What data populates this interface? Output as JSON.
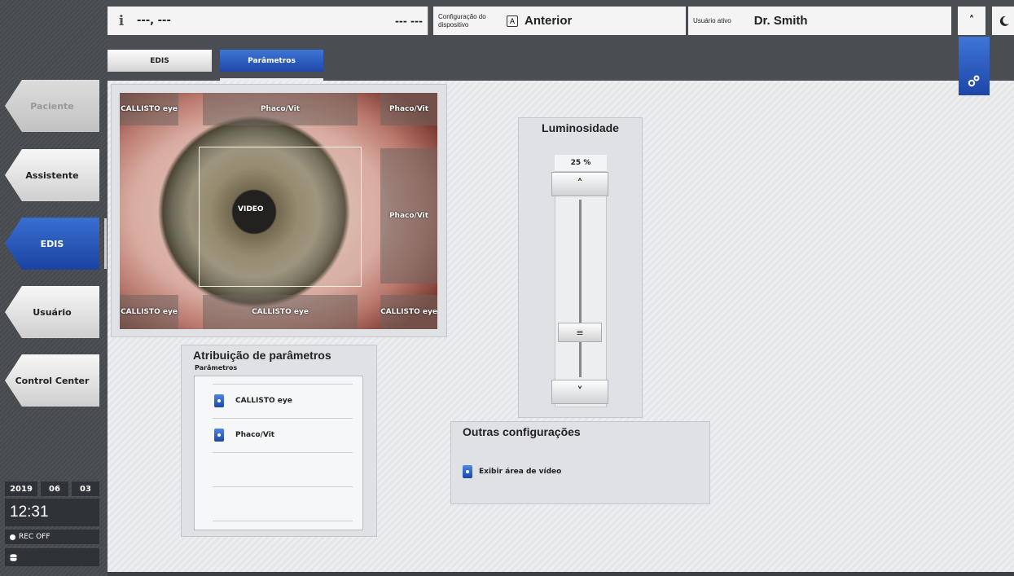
{
  "sidebar": {
    "items": [
      {
        "label": "Paciente",
        "state": "disabled"
      },
      {
        "label": "Assistente",
        "state": "normal"
      },
      {
        "label": "EDIS",
        "state": "active"
      },
      {
        "label": "Usuário",
        "state": "normal"
      },
      {
        "label": "Control Center",
        "state": "normal"
      }
    ],
    "date": {
      "year": "2019",
      "month": "06",
      "day": "03"
    },
    "time": "12:31",
    "rec_status": "REC OFF",
    "storage_icon": "database-icon"
  },
  "header": {
    "info_icon": "info-icon",
    "patient_name": "---, ---",
    "patient_date": "--- ---",
    "config_label": "Configuração do dispositivo",
    "config_icon_letter": "A",
    "config_value": "Anterior",
    "user_label": "Usuário ativo",
    "user_name": "Dr. Smith",
    "up_icon": "^",
    "moon_icon": "moon-icon"
  },
  "tabs": [
    {
      "label": "EDIS",
      "active": false
    },
    {
      "label": "Parâmetros",
      "active": true
    }
  ],
  "eye_overlay": {
    "zones": {
      "top_left": "CALLISTO eye",
      "top_center": "Phaco/Vit",
      "top_right": "Phaco/Vit",
      "middle_right": "Phaco/Vit",
      "bottom_left": "CALLISTO eye",
      "bottom_center": "CALLISTO eye",
      "bottom_right": "CALLISTO eye",
      "center": "VIDEO"
    }
  },
  "assignment": {
    "title": "Atribuição de parâmetros",
    "subtitle": "Parâmetros",
    "items": [
      "CALLISTO eye",
      "Phaco/Vit"
    ]
  },
  "luminosity": {
    "title": "Luminosidade",
    "value": "25 %",
    "level_percent": 25,
    "up_icon": "^",
    "down_icon": "v",
    "thumb_icon": "≡"
  },
  "other_settings": {
    "title": "Outras configurações",
    "item": "Exibir área de vídeo"
  },
  "colors": {
    "accent_blue": "#1e48aa",
    "panel_bg": "#dfe1e4",
    "sidebar_bg": "#4a4d51"
  }
}
